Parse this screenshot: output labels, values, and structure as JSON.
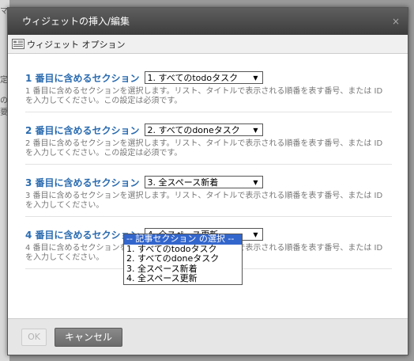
{
  "background": {
    "fragments": [
      "マ",
      "定",
      "の要"
    ]
  },
  "dialog": {
    "title": "ウィジェットの挿入/編集",
    "close_label": "×",
    "tab_label": "ウィジェット オプション"
  },
  "fields": [
    {
      "label": "1 番目に含めるセクション",
      "selected": "1. すべてのtodoタスク",
      "description": "1 番目に含めるセクションを選択します。リスト、タイトルで表示される順番を表す番号、または ID を入力してください。この設定は必須です。"
    },
    {
      "label": "2 番目に含めるセクション",
      "selected": "2. すべてのdoneタスク",
      "description": "2 番目に含めるセクションを選択します。リスト、タイトルで表示される順番を表す番号、または ID を入力してください。この設定は必須です。"
    },
    {
      "label": "3 番目に含めるセクション",
      "selected": "3. 全スペース新着",
      "description": "3 番目に含めるセクションを選択します。リスト、タイトルで表示される順番を表す番号、または ID を入力してください。"
    },
    {
      "label": "4 番目に含めるセクション",
      "selected": "4. 全スペース更新",
      "description": "4 番目に含めるセクションを選択します。リスト、タイトルで表示される順番を表す番号、または ID を入力してください。"
    }
  ],
  "dropdown": {
    "options": [
      "-- 記事セクション の選択 --",
      "1. すべてのtodoタスク",
      "2. すべてのdoneタスク",
      "3. 全スペース新着",
      "4. 全スペース更新"
    ],
    "highlighted_index": 0
  },
  "footer": {
    "ok_label": "OK",
    "cancel_label": "キャンセル"
  }
}
